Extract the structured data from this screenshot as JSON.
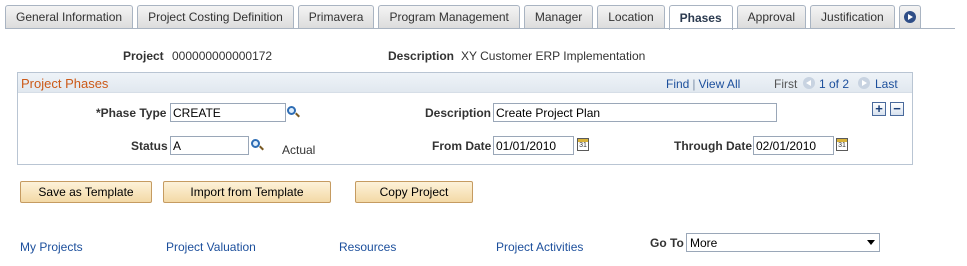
{
  "tabs": [
    {
      "label": "General Information",
      "active": false
    },
    {
      "label": "Project Costing Definition",
      "active": false
    },
    {
      "label": "Primavera",
      "active": false
    },
    {
      "label": "Program Management",
      "active": false
    },
    {
      "label": "Manager",
      "active": false
    },
    {
      "label": "Location",
      "active": false
    },
    {
      "label": "Phases",
      "active": true
    },
    {
      "label": "Approval",
      "active": false
    },
    {
      "label": "Justification",
      "active": false
    }
  ],
  "header": {
    "project_label": "Project",
    "project_value": "000000000000172",
    "description_label": "Description",
    "description_value": "XY Customer ERP Implementation"
  },
  "grid": {
    "title": "Project Phases",
    "find": "Find",
    "separator": "|",
    "view_all": "View All",
    "first": "First",
    "count": "1 of 2",
    "last": "Last",
    "add_row": "+",
    "delete_row": "−"
  },
  "phase": {
    "phase_type_label": "*Phase Type",
    "phase_type_value": "CREATE",
    "description_label": "Description",
    "description_value": "Create Project Plan",
    "status_label": "Status",
    "status_value": "A",
    "status_text": "Actual",
    "from_date_label": "From Date",
    "from_date_value": "01/01/2010",
    "through_date_label": "Through Date",
    "through_date_value": "02/01/2010"
  },
  "buttons": {
    "save_template": "Save as Template",
    "import_template": "Import from Template",
    "copy_project": "Copy Project"
  },
  "footer": {
    "links": [
      "My Projects",
      "Project Valuation",
      "Resources",
      "Project Activities"
    ],
    "goto_label": "Go To",
    "goto_value": "More"
  },
  "colors": {
    "grid_title": "#cc5a19",
    "link": "#1c4f9c",
    "button_bg": "#f3d9a6"
  },
  "icons": {
    "lookup": "magnifier-icon",
    "calendar": "calendar-icon",
    "tab_scroll": "arrow-right-icon"
  }
}
